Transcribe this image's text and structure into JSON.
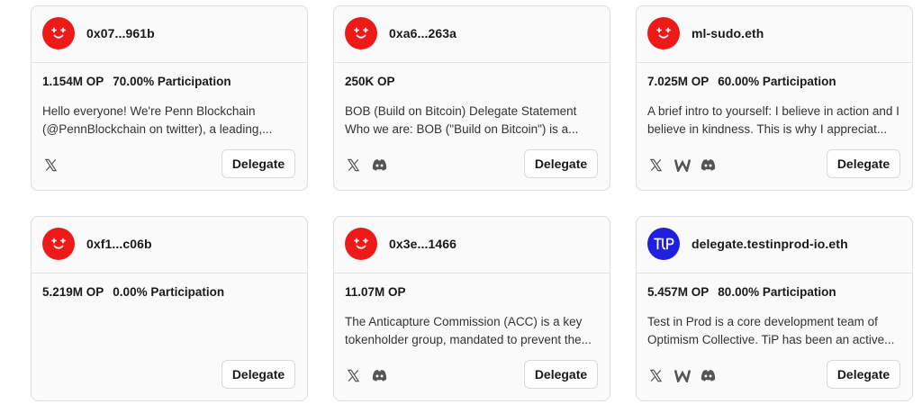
{
  "colors": {
    "avatar_red": "#ee1a1a",
    "avatar_blue": "#1f1fe0",
    "card_bg": "#fafafa"
  },
  "delegate_label": "Delegate",
  "cards": [
    {
      "name": "0x07...961b",
      "avatar": "optimism-avatar",
      "voting_power": "1.154M OP",
      "participation": "70.00% Participation",
      "description": "Hello everyone! We're Penn Blockchain (@PennBlockchain on twitter), a leading,...",
      "socials": [
        "x-icon"
      ]
    },
    {
      "name": "0xa6...263a",
      "avatar": "optimism-avatar",
      "voting_power": "250K OP",
      "participation": "",
      "description": "BOB (Build on Bitcoin) Delegate Statement Who we are: BOB (\"Build on Bitcoin\") is a...",
      "socials": [
        "x-icon",
        "discord-icon"
      ]
    },
    {
      "name": "ml-sudo.eth",
      "avatar": "optimism-avatar",
      "voting_power": "7.025M OP",
      "participation": "60.00% Participation",
      "description": "A brief intro to yourself: I believe in action and I believe in kindness. This is why I appreciat...",
      "socials": [
        "x-icon",
        "warpcast-icon",
        "discord-icon"
      ]
    },
    {
      "name": "0xf1...c06b",
      "avatar": "optimism-avatar",
      "voting_power": "5.219M OP",
      "participation": "0.00% Participation",
      "description": "",
      "socials": []
    },
    {
      "name": "0x3e...1466",
      "avatar": "optimism-avatar",
      "voting_power": "11.07M OP",
      "participation": "",
      "description": "The Anticapture Commission (ACC) is a key tokenholder group, mandated to prevent the...",
      "socials": [
        "x-icon",
        "discord-icon"
      ]
    },
    {
      "name": "delegate.testinprod-io.eth",
      "avatar": "tip-logo-avatar",
      "avatar_text": "TIP",
      "voting_power": "5.457M OP",
      "participation": "80.00% Participation",
      "description": "Test in Prod is a core development team of Optimism Collective. TiP has been an active...",
      "socials": [
        "x-icon",
        "warpcast-icon",
        "discord-icon"
      ]
    }
  ]
}
